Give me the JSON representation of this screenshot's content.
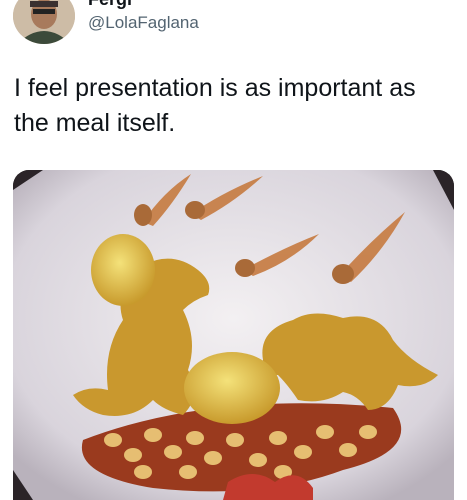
{
  "author": {
    "display_name": "Fergi",
    "handle": "@LolaFaglana",
    "avatar_icon": "profile-photo"
  },
  "tweet": {
    "text": "I feel presentation is as important as the meal itself."
  },
  "actions": {
    "more_icon": "ellipsis-icon",
    "more_glyph": "···"
  },
  "media": {
    "alt_icon": "food-plate-photo"
  },
  "colors": {
    "text": "#0f1419",
    "secondary": "#536471",
    "background": "#ffffff"
  }
}
